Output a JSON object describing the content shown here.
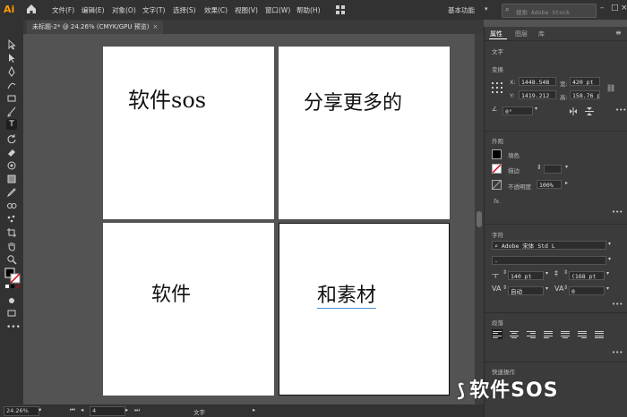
{
  "app": {
    "logo": "Ai",
    "menu": [
      "文件(F)",
      "编辑(E)",
      "对象(O)",
      "文字(T)",
      "选择(S)",
      "效果(C)",
      "视图(V)",
      "窗口(W)",
      "帮助(H)"
    ],
    "workspace": "基本功能",
    "search_placeholder": "搜索 Adobe Stock"
  },
  "document": {
    "tab_title": "未标题-2* @ 24.26% (CMYK/GPU 预览)",
    "tab_close": "×"
  },
  "artboards": [
    {
      "text": "软件sos"
    },
    {
      "text": "分享更多的"
    },
    {
      "text": "软件"
    },
    {
      "text": "和素材"
    }
  ],
  "statusbar": {
    "zoom": "24.26%",
    "artboard_num": "4",
    "tool_name": "文字"
  },
  "panel": {
    "tabs": [
      "属性",
      "图层",
      "库"
    ],
    "selection_type": "文字",
    "transform": {
      "title": "变换",
      "x_label": "X:",
      "x": "1448.548",
      "y_label": "Y:",
      "y": "1419.212",
      "w_label": "宽:",
      "w": "420 pt",
      "h_label": "高:",
      "h": "158.76 p",
      "rotate": "0°"
    },
    "appearance": {
      "title": "外观",
      "fill_label": "填色",
      "stroke_label": "描边",
      "opacity_label": "不透明度",
      "opacity": "100%",
      "fx": "fx."
    },
    "character": {
      "title": "字符",
      "font": "Adobe 宋体 Std L",
      "style": "-",
      "size": "140 pt",
      "leading": "(168 pt",
      "kerning": "自动",
      "tracking": "0"
    },
    "paragraph": {
      "title": "段落"
    },
    "quick_actions": {
      "title": "快速操作"
    }
  },
  "watermark": "软件SOS",
  "colors": {
    "accent": "#ff9a00",
    "stroke_none": "#d0021b"
  }
}
